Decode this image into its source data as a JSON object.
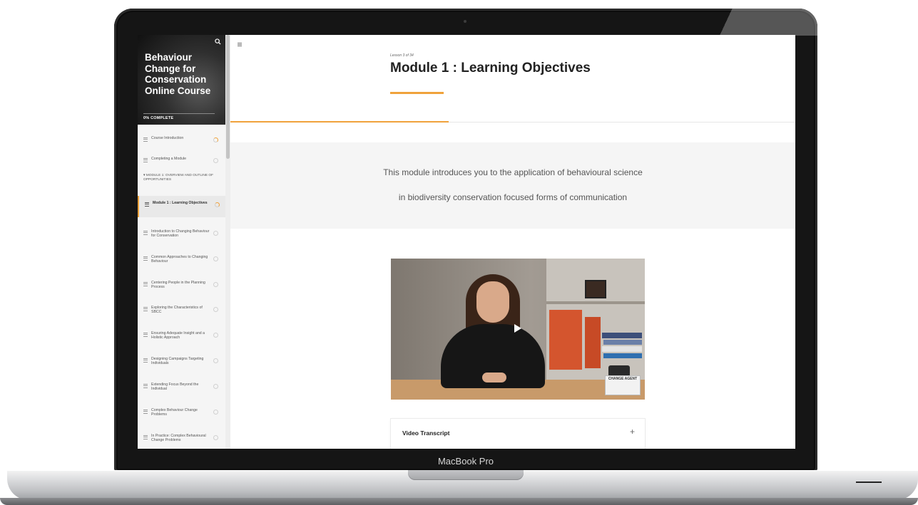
{
  "device": {
    "label": "MacBook Pro"
  },
  "sidebar": {
    "course_title": "Behaviour Change for Conservation Online Course",
    "progress_label": "0% COMPLETE",
    "progress_value": 0,
    "items": [
      {
        "label": "Course Introduction",
        "status": "in-progress"
      },
      {
        "label": "Completing a Module",
        "status": "not-started"
      },
      {
        "label": "Module 1 : Learning Objectives",
        "status": "in-progress",
        "active": true
      },
      {
        "label": "Introduction to Changing Behaviour for Conservation",
        "status": "not-started"
      },
      {
        "label": "Common Approaches to Changing Behaviour",
        "status": "not-started"
      },
      {
        "label": "Centering People in the Planning Process",
        "status": "not-started"
      },
      {
        "label": "Exploring the Characteristics of SBCC",
        "status": "not-started"
      },
      {
        "label": "Ensuring Adequate Insight and a Holistic Approach",
        "status": "not-started"
      },
      {
        "label": "Designing Campaigns Targeting Individuals",
        "status": "not-started"
      },
      {
        "label": "Extending Focus Beyond the Individual",
        "status": "not-started"
      },
      {
        "label": "Complex Behaviour Change Problems",
        "status": "not-started"
      },
      {
        "label": "In Practice: Complex Behavioural Change Problems",
        "status": "not-started"
      }
    ],
    "section_heading": "▾ MODULE 1: OVERVIEW AND OUTLINE OF OPPORTUNITIES"
  },
  "lesson": {
    "number": "Lesson 3 of 34",
    "title": "Module 1 : Learning Objectives",
    "intro_line1": "This module introduces you to the application of behavioural science",
    "intro_line2": "in biodiversity conservation focused forms of communication",
    "video_sign": "CHANGE AGENT",
    "transcript_label": "Video Transcript",
    "transcript_toggle": "+"
  },
  "colors": {
    "accent": "#f0a23b",
    "sidebar_bg": "#f5f5f5"
  },
  "icons": {
    "search": "search-icon",
    "menu": "hamburger-icon",
    "play": "play-icon",
    "lesson": "lines-icon"
  }
}
